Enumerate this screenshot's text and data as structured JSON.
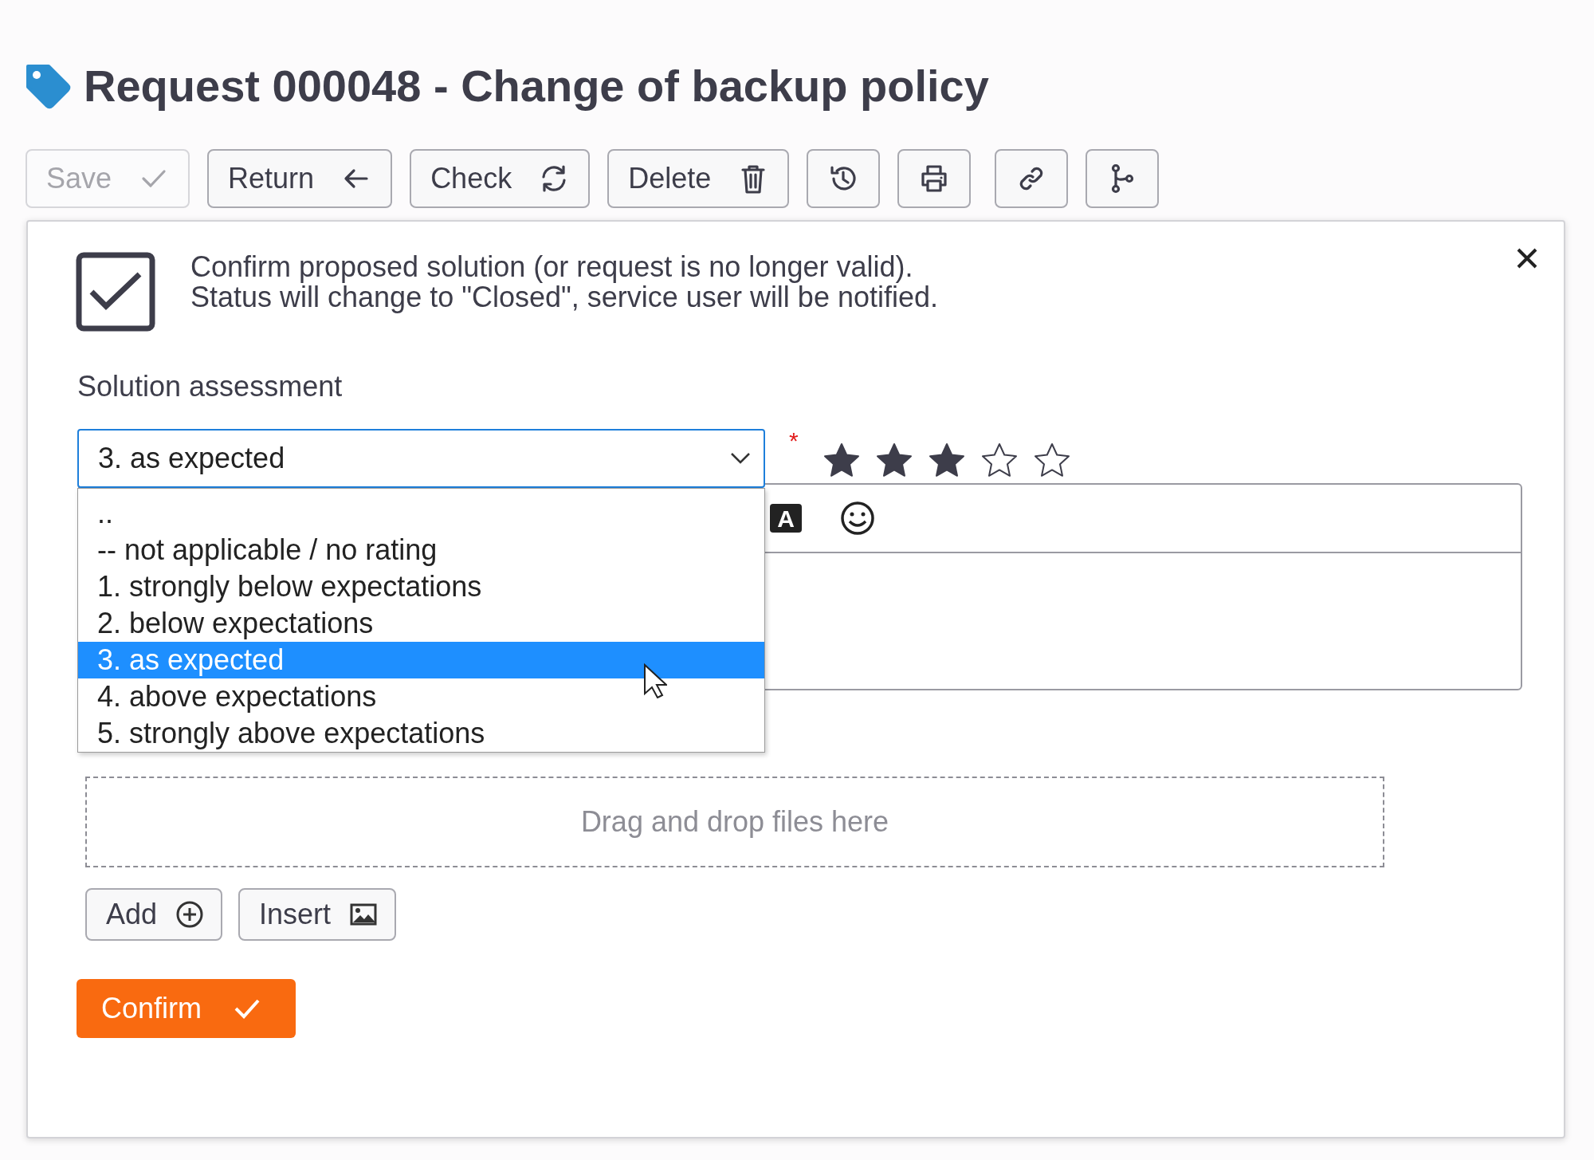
{
  "title": "Request 000048 - Change of backup policy",
  "toolbar": [
    {
      "kind": "text",
      "label": "Save",
      "disabled": true
    },
    {
      "kind": "text",
      "label": "Return",
      "disabled": false
    },
    {
      "kind": "text",
      "label": "Check",
      "disabled": false
    },
    {
      "kind": "text",
      "label": "Delete",
      "disabled": false
    },
    {
      "kind": "icon",
      "disabled": false
    },
    {
      "kind": "icon",
      "disabled": false
    },
    {
      "kind": "icon",
      "disabled": false
    },
    {
      "kind": "icon",
      "disabled": false
    }
  ],
  "dialog": {
    "message": [
      "Confirm proposed solution (or request is no longer valid).",
      "Status will change to \"Closed\", service user will be notified."
    ],
    "assessment": {
      "label": "Solution assessment",
      "value": "3. as expected",
      "required_mark": "*",
      "stars": 3,
      "options": [
        {
          "label": "..",
          "selected": false
        },
        {
          "label": "-- not applicable / no rating",
          "selected": false
        },
        {
          "label": "1. strongly below expectations",
          "selected": false
        },
        {
          "label": "2. below expectations",
          "selected": false
        },
        {
          "label": "3. as expected",
          "selected": true
        },
        {
          "label": "4. above expectations",
          "selected": false
        },
        {
          "label": "5. strongly above expectations",
          "selected": false
        }
      ]
    },
    "editor_toolbar": {
      "font_color_glyph": "A"
    },
    "dropzone": "Drag and drop files here",
    "attach_buttons": [
      "Add",
      "Insert"
    ],
    "confirm_button": "Confirm"
  }
}
